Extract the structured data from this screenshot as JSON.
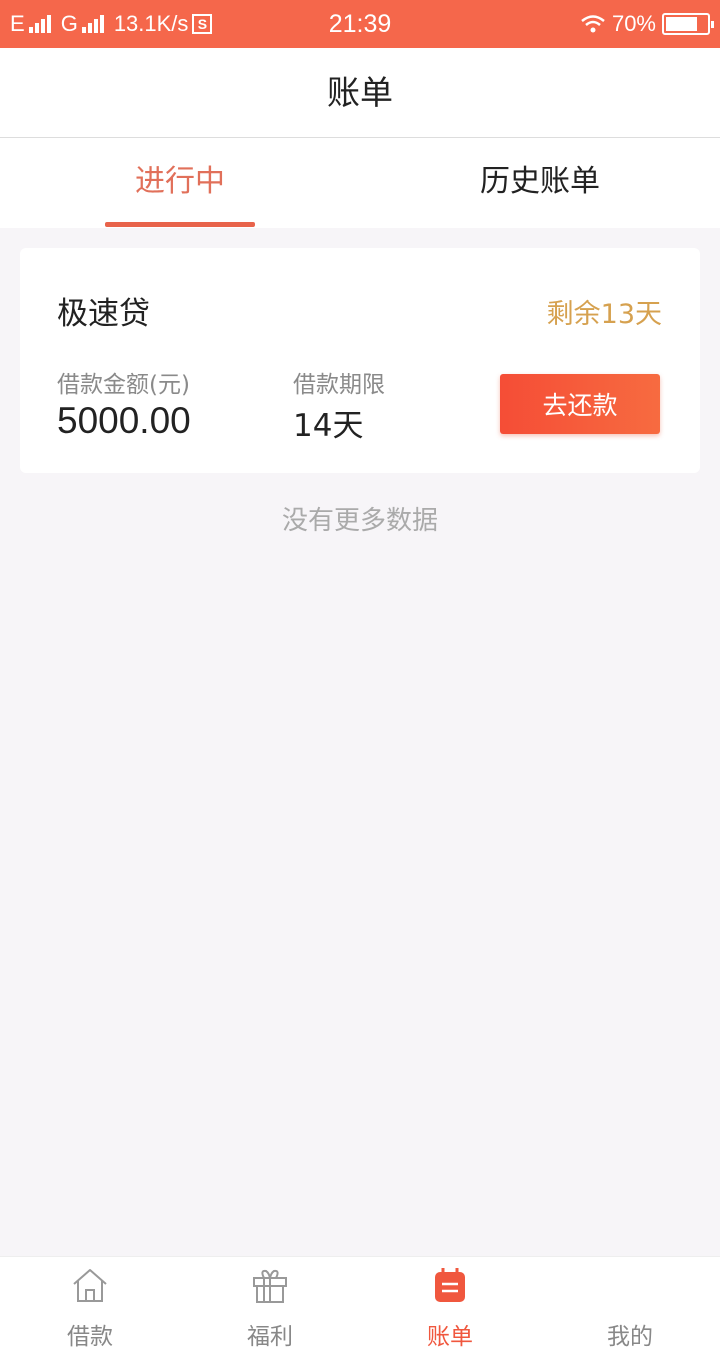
{
  "status_bar": {
    "network1": "E",
    "network2": "G",
    "speed": "13.1K/s",
    "s_badge": "S",
    "time": "21:39",
    "battery": "70%"
  },
  "header": {
    "title": "账单"
  },
  "tabs": [
    {
      "label": "进行中",
      "active": true
    },
    {
      "label": "历史账单",
      "active": false
    }
  ],
  "card": {
    "product": "极速贷",
    "remaining": "剩余13天",
    "amount_label": "借款金额(元)",
    "amount_value": "5000.00",
    "term_label": "借款期限",
    "term_value": "14天",
    "button": "去还款"
  },
  "no_more": "没有更多数据",
  "bottom_nav": [
    {
      "label": "借款",
      "icon": "home-icon"
    },
    {
      "label": "福利",
      "icon": "gift-icon"
    },
    {
      "label": "账单",
      "icon": "bill-icon",
      "active": true
    },
    {
      "label": "我的",
      "icon": "profile-icon"
    }
  ],
  "colors": {
    "accent": "#f5674b",
    "remaining": "#d6a14f",
    "button": "#f54d36"
  }
}
